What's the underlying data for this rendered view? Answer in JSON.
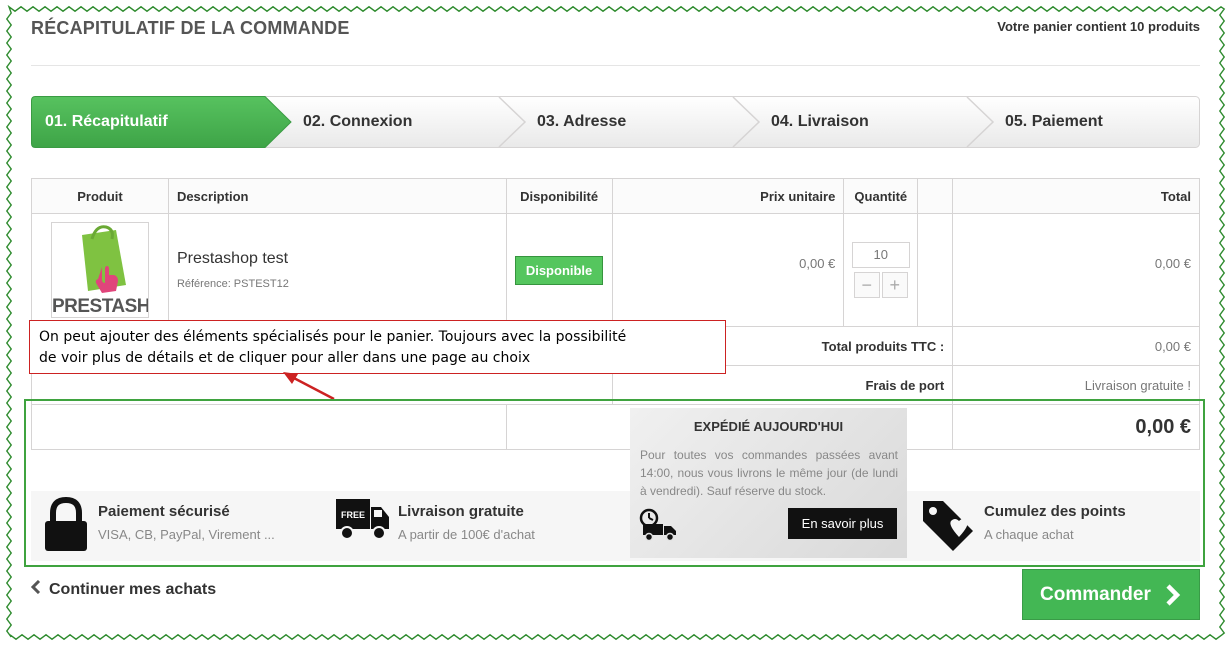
{
  "page": {
    "title": "RÉCAPITULATIF DE LA COMMANDE",
    "cart_summary": "Votre panier contient 10 produits"
  },
  "steps": [
    {
      "label": "01. Récapitulatif",
      "active": true
    },
    {
      "label": "02. Connexion",
      "active": false
    },
    {
      "label": "03. Adresse",
      "active": false
    },
    {
      "label": "04. Livraison",
      "active": false
    },
    {
      "label": "05. Paiement",
      "active": false
    }
  ],
  "table": {
    "headers": {
      "product": "Produit",
      "description": "Description",
      "availability": "Disponibilité",
      "unit_price": "Prix unitaire",
      "quantity": "Quantité",
      "total": "Total"
    },
    "item": {
      "logo_text": "PRESTASHOP",
      "name": "Prestashop test",
      "reference": "Référence: PSTEST12",
      "availability": "Disponible",
      "unit_price": "0,00 €",
      "quantity": "10",
      "total": "0,00 €"
    },
    "totals": {
      "products_label": "Total produits TTC :",
      "products_value": "0,00 €",
      "shipping_label": "Frais de port",
      "shipping_value": "Livraison gratuite !",
      "grand_total": "0,00 €"
    }
  },
  "annotation": {
    "line1": "On peut ajouter des éléments spécialisés pour le panier. Toujours avec la possibilité",
    "line2": "de voir plus de détails et de cliquer pour aller dans une page au choix"
  },
  "reassurance": [
    {
      "title": "Paiement sécurisé",
      "subtitle": "VISA, CB, PayPal, Virement ...",
      "icon": "lock-icon"
    },
    {
      "title": "Livraison gratuite",
      "subtitle": "A partir de 100€ d'achat",
      "icon": "free-truck-icon",
      "badge": "FREE"
    },
    {
      "title": "Cumulez des points",
      "subtitle": "A chaque achat",
      "icon": "tag-heart-icon"
    }
  ],
  "shipping_popup": {
    "title": "EXPÉDIÉ AUJOURD'HUI",
    "text": "Pour toutes vos commandes passées avant 14:00, nous vous livrons le même jour (de lundi à vendredi). Sauf réserve du stock.",
    "button": "En savoir plus"
  },
  "footer": {
    "continue_label": "Continuer mes achats",
    "order_label": "Commander"
  },
  "colors": {
    "primary_green": "#43b754",
    "frame_green": "#3fa33f",
    "annotation_red": "#cc2222"
  }
}
